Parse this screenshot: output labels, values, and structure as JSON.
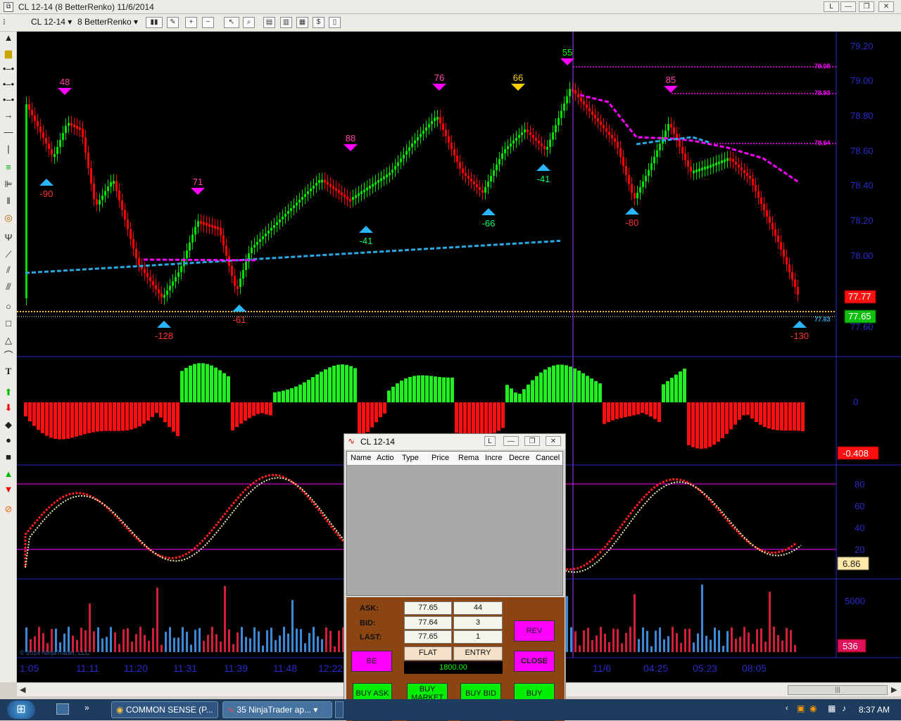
{
  "window": {
    "title": "CL 12-14 (8 BetterRenko)  11/6/2014",
    "buttons": [
      "L",
      "—",
      "❐",
      "✕"
    ]
  },
  "toolbar": {
    "instrument": "CL 12-14",
    "period": "8 BetterRenko"
  },
  "price_axis": [
    "79.20",
    "79.00",
    "78.80",
    "78.60",
    "78.40",
    "78.20",
    "78.00",
    "77.60"
  ],
  "price_tags": {
    "red": "77.77",
    "green": "77.65"
  },
  "level_labels": [
    "79.08",
    "78.93",
    "78.64",
    "77.63"
  ],
  "markers": {
    "top": [
      "48",
      "71",
      "88",
      "76",
      "66",
      "55",
      "85"
    ],
    "bottom": [
      "-90",
      "-128",
      "-61",
      "-41",
      "-66",
      "-41",
      "-80",
      "-130"
    ]
  },
  "histogram_panel": {
    "axis_zero": "0",
    "value": "-0.408"
  },
  "stoch_panel": {
    "axis": [
      "80",
      "60",
      "40",
      "20"
    ],
    "value": "6.86"
  },
  "volume_panel": {
    "axis": "5000",
    "value": "536",
    "watermark": "© 2014 NinjaTrader, LLC"
  },
  "time_axis": [
    "1:05",
    "11:11",
    "11:20",
    "11:31",
    "11:39",
    "11:48",
    "12:22",
    "11/6",
    "04:25",
    "05:23",
    "08:05"
  ],
  "order_window": {
    "title": "CL 12-14",
    "columns": [
      "Name",
      "Actio",
      "Type",
      "Price",
      "Rema",
      "Incre",
      "Decre",
      "Cancel"
    ],
    "ask_label": "ASK:",
    "ask_price": "77.65",
    "ask_size": "44",
    "bid_label": "BID:",
    "bid_price": "77.64",
    "bid_size": "3",
    "last_label": "LAST:",
    "last_price": "77.65",
    "last_size": "1",
    "position": "FLAT",
    "entry": "ENTRY",
    "pnl": "1800.00",
    "rev": "REV",
    "be": "BE",
    "close": "CLOSE",
    "buy_ask": "BUY ASK",
    "buy_market": "BUY MARKET",
    "buy_bid": "BUY BID",
    "buy": "BUY"
  },
  "taskbar": {
    "tasks": [
      "COMMON SENSE (P...",
      "35 NinjaTrader ap..."
    ],
    "clock": "8:37 AM"
  },
  "colors": {
    "up_candle": "#00dd00",
    "down_candle": "#ff0000",
    "ma_cyan": "#29a8e0",
    "ma_magenta": "#ff00ff",
    "axis_blue": "#2a2ac8",
    "level_magenta": "#ff00ff"
  }
}
